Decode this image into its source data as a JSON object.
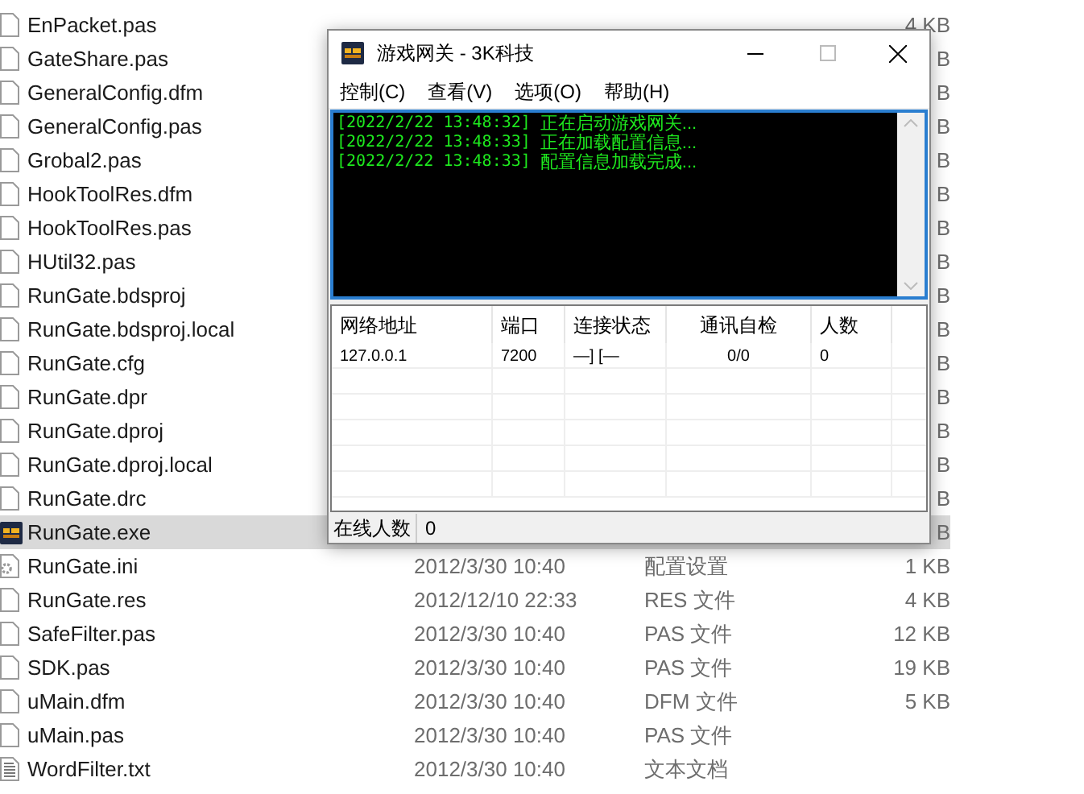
{
  "files": [
    {
      "name": "EnPacket.pas",
      "kind": "doc",
      "selected": false,
      "size": "4 KB"
    },
    {
      "name": "GateShare.pas",
      "kind": "doc",
      "selected": false,
      "size": "B"
    },
    {
      "name": "GeneralConfig.dfm",
      "kind": "doc",
      "selected": false,
      "size": "B"
    },
    {
      "name": "GeneralConfig.pas",
      "kind": "doc",
      "selected": false,
      "size": "B"
    },
    {
      "name": "Grobal2.pas",
      "kind": "doc",
      "selected": false,
      "size": "B"
    },
    {
      "name": "HookToolRes.dfm",
      "kind": "doc",
      "selected": false,
      "size": "B"
    },
    {
      "name": "HookToolRes.pas",
      "kind": "doc",
      "selected": false,
      "size": "B"
    },
    {
      "name": "HUtil32.pas",
      "kind": "doc",
      "selected": false,
      "size": "B"
    },
    {
      "name": "RunGate.bdsproj",
      "kind": "doc",
      "selected": false,
      "size": "B"
    },
    {
      "name": "RunGate.bdsproj.local",
      "kind": "doc",
      "selected": false,
      "size": "B"
    },
    {
      "name": "RunGate.cfg",
      "kind": "doc",
      "selected": false,
      "size": "B"
    },
    {
      "name": "RunGate.dpr",
      "kind": "doc",
      "selected": false,
      "size": "B"
    },
    {
      "name": "RunGate.dproj",
      "kind": "doc",
      "selected": false,
      "size": "B"
    },
    {
      "name": "RunGate.dproj.local",
      "kind": "doc",
      "selected": false,
      "size": "B"
    },
    {
      "name": "RunGate.drc",
      "kind": "doc",
      "selected": false,
      "size": "B"
    },
    {
      "name": "RunGate.exe",
      "kind": "exe",
      "selected": true,
      "size": "B"
    },
    {
      "name": "RunGate.ini",
      "kind": "ini",
      "selected": false,
      "date": "2012/3/30 10:40",
      "type": "配置设置",
      "size": "1 KB"
    },
    {
      "name": "RunGate.res",
      "kind": "doc",
      "selected": false,
      "date": "2012/12/10 22:33",
      "type": "RES 文件",
      "size": "4 KB"
    },
    {
      "name": "SafeFilter.pas",
      "kind": "doc",
      "selected": false,
      "date": "2012/3/30 10:40",
      "type": "PAS 文件",
      "size": "12 KB"
    },
    {
      "name": "SDK.pas",
      "kind": "doc",
      "selected": false,
      "date": "2012/3/30 10:40",
      "type": "PAS 文件",
      "size": "19 KB"
    },
    {
      "name": "uMain.dfm",
      "kind": "doc",
      "selected": false,
      "date": "2012/3/30 10:40",
      "type": "DFM 文件",
      "size": "5 KB"
    },
    {
      "name": "uMain.pas",
      "kind": "doc",
      "selected": false,
      "date": "2012/3/30 10:40",
      "type": "PAS 文件"
    },
    {
      "name": "WordFilter.txt",
      "kind": "txt",
      "selected": false,
      "date": "2012/3/30 10:40",
      "type": "文本文档"
    }
  ],
  "window": {
    "title": "游戏网关 - 3K科技",
    "menu": [
      "控制(C)",
      "查看(V)",
      "选项(O)",
      "帮助(H)"
    ],
    "log": [
      {
        "time": "[2022/2/22 13:48:32]",
        "message": "正在启动游戏网关..."
      },
      {
        "time": "[2022/2/22 13:48:33]",
        "message": "正在加载配置信息..."
      },
      {
        "time": "[2022/2/22 13:48:33]",
        "message": "配置信息加载完成..."
      }
    ],
    "table": {
      "columns": [
        "网络地址",
        "端口",
        "连接状态",
        "通讯自检",
        "人数"
      ],
      "rows": [
        [
          "127.0.0.1",
          "7200",
          "—]  [—",
          "0/0",
          "0"
        ]
      ]
    },
    "status_bar": {
      "label": "在线人数",
      "value": "0"
    }
  }
}
